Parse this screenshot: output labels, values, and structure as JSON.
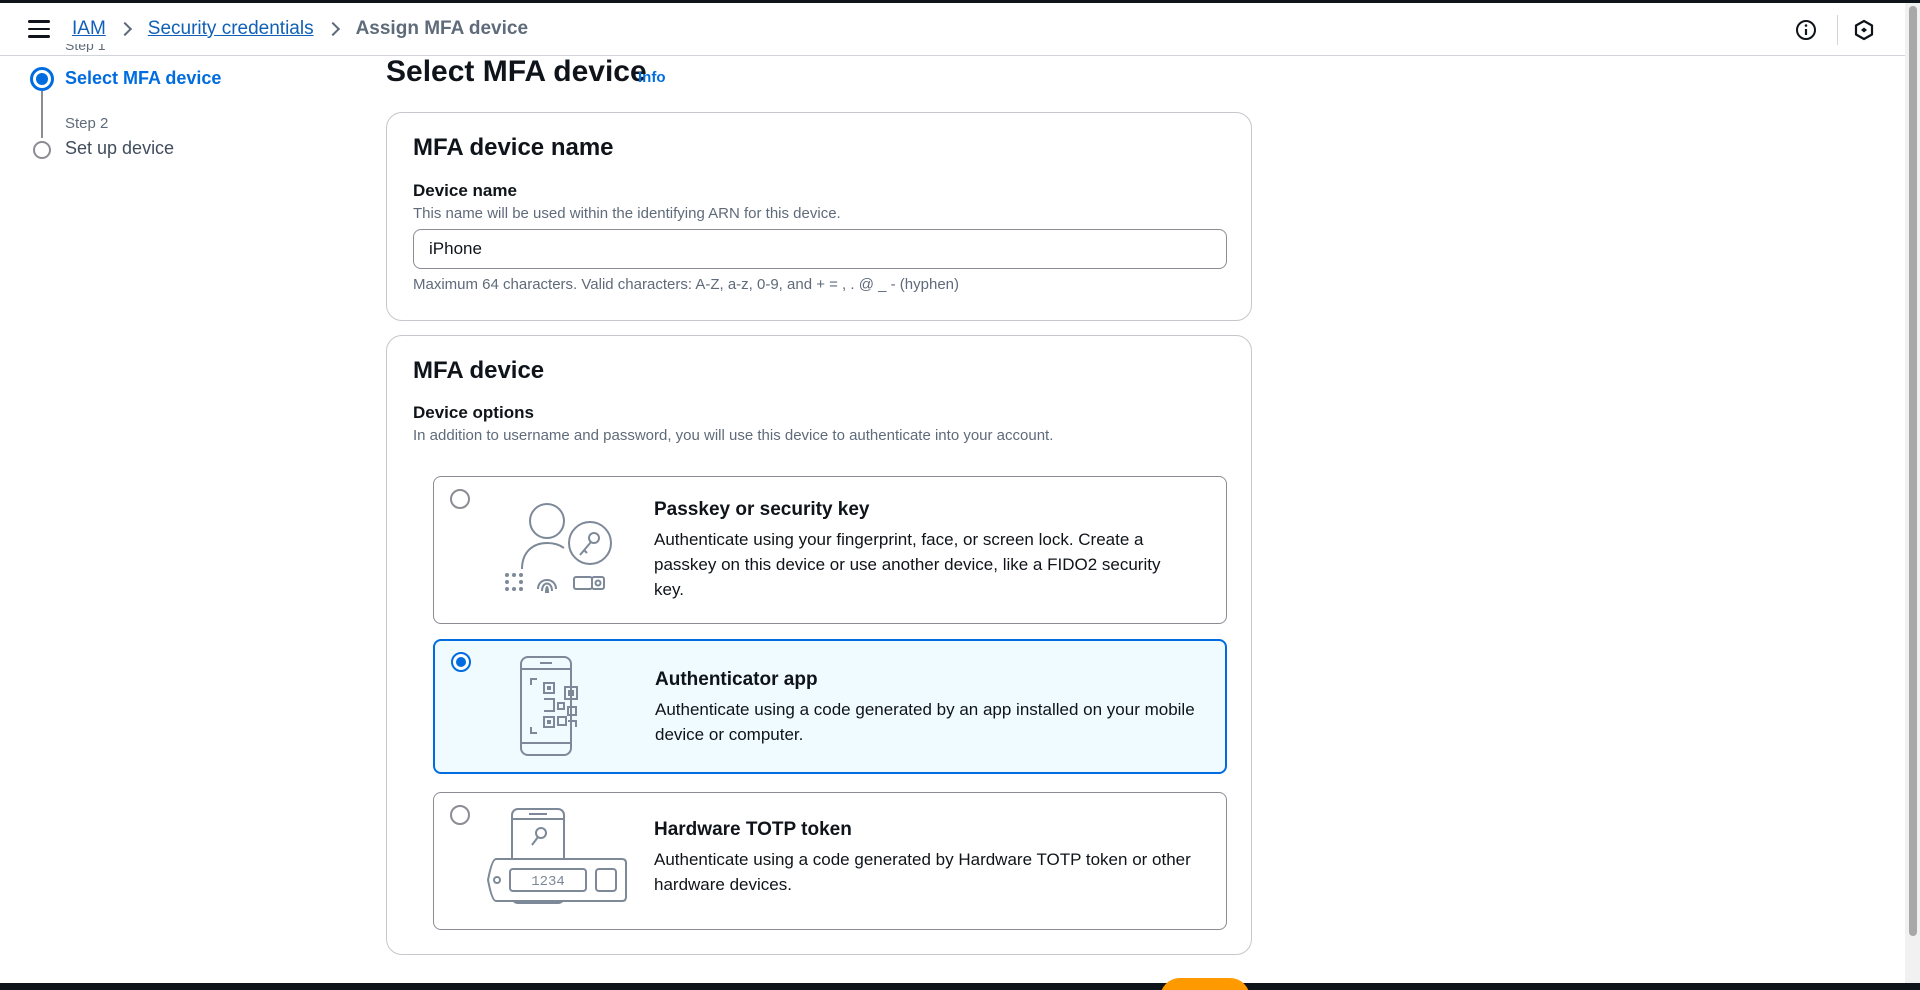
{
  "header": {
    "breadcrumb": [
      {
        "label": "IAM",
        "link": true
      },
      {
        "label": "Security credentials",
        "link": true
      },
      {
        "label": "Assign MFA device",
        "link": false
      }
    ],
    "icons": [
      "menu-icon",
      "info-icon",
      "hexagon-settings-icon"
    ]
  },
  "steps": {
    "step1_label": "Step 1",
    "step1_title": "Select MFA device",
    "step2_label": "Step 2",
    "step2_title": "Set up device"
  },
  "main": {
    "title": "Select MFA device",
    "info_link": "Info"
  },
  "name_card": {
    "title": "MFA device name",
    "field_label": "Device name",
    "field_desc": "This name will be used within the identifying ARN for this device.",
    "value": "iPhone",
    "constraint": "Maximum 64 characters. Valid characters: A-Z, a-z, 0-9, and + = , . @ _ - (hyphen)"
  },
  "device_card": {
    "title": "MFA device",
    "field_label": "Device options",
    "field_desc": "In addition to username and password, you will use this device to authenticate into your account.",
    "options": [
      {
        "title": "Passkey or security key",
        "desc": "Authenticate using your fingerprint, face, or screen lock. Create a passkey on this device or use another device, like a FIDO2 security key.",
        "selected": false,
        "icon": "passkey-icon"
      },
      {
        "title": "Authenticator app",
        "desc": "Authenticate using a code generated by an app installed on your mobile device or computer.",
        "selected": true,
        "icon": "phone-qr-icon"
      },
      {
        "title": "Hardware TOTP token",
        "desc": "Authenticate using a code generated by Hardware TOTP token or other hardware devices.",
        "selected": false,
        "icon": "hardware-token-icon",
        "token_digits": "1234"
      }
    ]
  },
  "colors": {
    "accent": "#006ce0",
    "link": "#0f60b6",
    "selected_bg": "#f0fbff",
    "primary_button": "#ff9900"
  }
}
